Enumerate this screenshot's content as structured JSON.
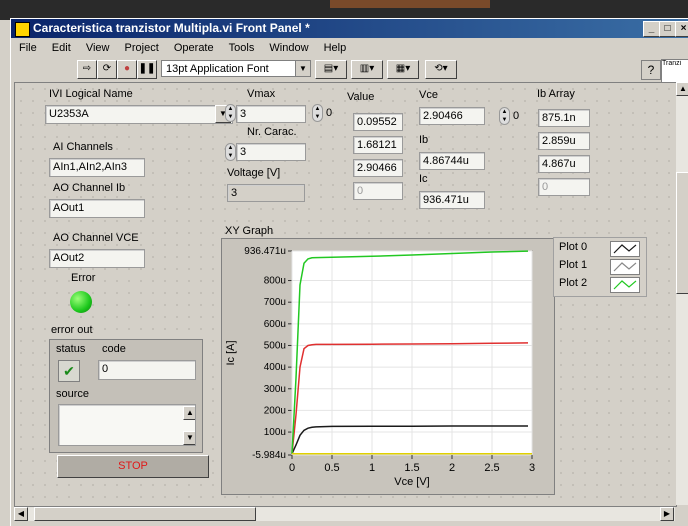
{
  "window": {
    "title": "Caracteristica tranzistor Multipla.vi Front Panel *",
    "buttons": [
      "_",
      "□",
      "×"
    ]
  },
  "menu": [
    "File",
    "Edit",
    "View",
    "Project",
    "Operate",
    "Tools",
    "Window",
    "Help"
  ],
  "toolbar": {
    "font": "13pt Application Font",
    "help": "?",
    "context_help_text": "Tranzi"
  },
  "controls": {
    "ivi_label": "IVI Logical Name",
    "ivi_value": "U2353A",
    "ai_label": "AI Channels",
    "ai_value": "AIn1,AIn2,AIn3",
    "ao_ib_label": "AO Channel Ib",
    "ao_ib_value": "AOut1",
    "ao_vce_label": "AO Channel VCE",
    "ao_vce_value": "AOut2",
    "error_label": "Error",
    "vmax_label": "Vmax",
    "vmax_value": "3",
    "vmax_index": "0",
    "nrcarac_label": "Nr. Carac.",
    "nrcarac_value": "3",
    "voltage_label": "Voltage [V]",
    "voltage_value": "3",
    "value_label": "Value",
    "value_items": [
      "0.09552",
      "1.68121",
      "2.90466",
      "0"
    ],
    "vce_label": "Vce",
    "vce_value": "2.90466",
    "vce_index": "0",
    "ib_label": "Ib",
    "ib_value": "4.86744u",
    "ic_label": "Ic",
    "ic_value": "936.471u",
    "ib_array_label": "Ib Array",
    "ib_array": [
      "875.1n",
      "2.859u",
      "4.867u",
      "0"
    ],
    "error_out_label": "error out",
    "status_label": "status",
    "status_mark": "✔",
    "code_label": "code",
    "code_value": "0",
    "source_label": "source",
    "stop_label": "STOP",
    "graph_label": "XY Graph"
  },
  "chart_data": {
    "type": "line",
    "title": "",
    "xlabel": "Vce [V]",
    "ylabel": "Ic [A]",
    "xlim": [
      0,
      3
    ],
    "ylim": [
      -5.984e-06,
      0.000936471
    ],
    "x_ticks": [
      "0",
      "0.5",
      "1",
      "1.5",
      "2",
      "2.5",
      "3"
    ],
    "y_ticks": [
      "936.471u",
      "800u",
      "700u",
      "600u",
      "500u",
      "400u",
      "300u",
      "200u",
      "100u",
      "-5.984u"
    ],
    "grid": true,
    "legend_position": "top-right",
    "series": [
      {
        "name": "Plot 0",
        "color": "#1a1a1a",
        "x": [
          0,
          0.05,
          0.1,
          0.15,
          0.2,
          0.25,
          0.3,
          0.5,
          1.0,
          1.5,
          2.0,
          2.5,
          2.95
        ],
        "y": [
          0,
          4e-05,
          8.5e-05,
          0.000108,
          0.000118,
          0.000122,
          0.000124,
          0.000126,
          0.000127,
          0.000127,
          0.000128,
          0.000128,
          0.000128
        ]
      },
      {
        "name": "Plot 1",
        "color": "#e03030",
        "x": [
          0,
          0.05,
          0.1,
          0.15,
          0.2,
          0.25,
          0.3,
          0.5,
          1.0,
          1.5,
          2.0,
          2.5,
          2.95
        ],
        "y": [
          0,
          0.00018,
          0.0004,
          0.000485,
          0.0005,
          0.000503,
          0.000505,
          0.000505,
          0.000506,
          0.000507,
          0.000508,
          0.00051,
          0.000512
        ]
      },
      {
        "name": "Plot 2",
        "color": "#22c822",
        "x": [
          0,
          0.05,
          0.1,
          0.15,
          0.2,
          0.25,
          0.3,
          0.5,
          1.0,
          1.5,
          2.0,
          2.5,
          2.95
        ],
        "y": [
          0,
          0.00035,
          0.00078,
          0.00088,
          0.0009,
          0.000905,
          0.000906,
          0.000908,
          0.000912,
          0.000918,
          0.000925,
          0.000932,
          0.000936
        ]
      },
      {
        "name": "",
        "color": "#e0d000",
        "x": [
          0,
          3
        ],
        "y": [
          0,
          0
        ]
      }
    ]
  }
}
